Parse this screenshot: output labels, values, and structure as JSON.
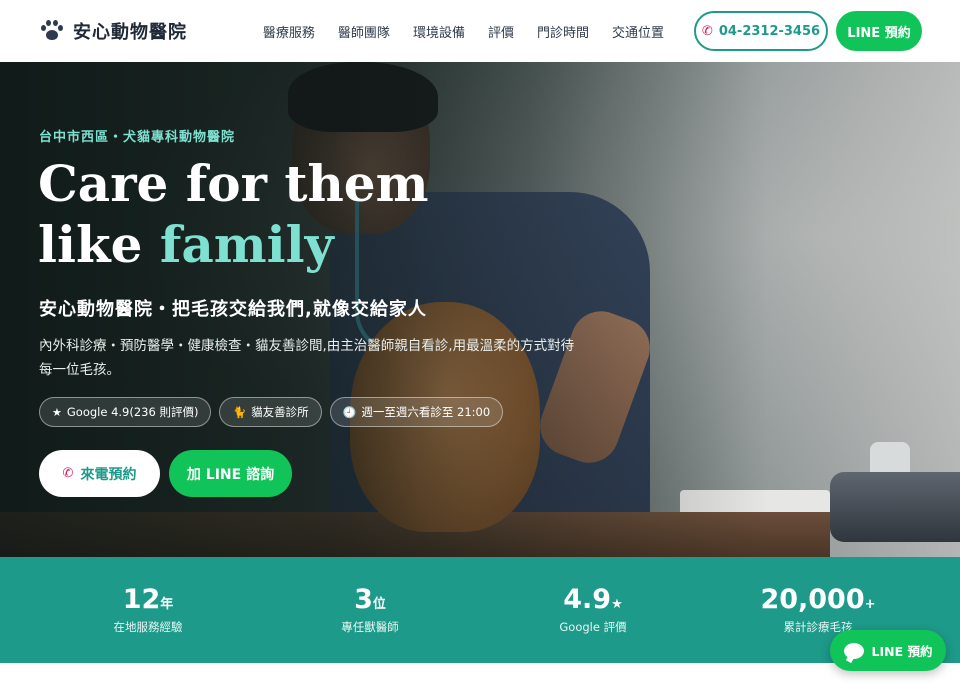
{
  "nav": {
    "brand": "安心動物醫院",
    "menu": [
      "醫療服務",
      "醫師團隊",
      "環境設備",
      "評價",
      "門診時間",
      "交通位置"
    ],
    "phone": "04-2312-3456",
    "line_button": "LINE 預約"
  },
  "hero": {
    "eyebrow": "台中市西區・犬貓專科動物醫院",
    "headline_line1": "Care for them",
    "headline_line2_prefix": "like ",
    "headline_line2_accent": "family",
    "subhead": "安心動物醫院・把毛孩交給我們,就像交給家人",
    "description": "內外科診療・預防醫學・健康檢查・貓友善診間,由主治醫師親自看診,用最溫柔的方式對待每一位毛孩。",
    "tags": [
      {
        "icon": "★",
        "label": "Google 4.9(236 則評價)"
      },
      {
        "icon": "🐈",
        "label": "貓友善診所"
      },
      {
        "icon": "🕘",
        "label": "週一至週六看診至 21:00"
      }
    ],
    "cta_call": "來電預約",
    "cta_line": "加 LINE 諮詢"
  },
  "stats": [
    {
      "value": "12",
      "unit": "年",
      "label": "在地服務經驗"
    },
    {
      "value": "3",
      "unit": "位",
      "label": "專任獸醫師"
    },
    {
      "value": "4.9",
      "unit": "★",
      "label": "Google 評價"
    },
    {
      "value": "20,000",
      "unit": "+",
      "label": "累計診療毛孩"
    }
  ],
  "float_line": "LINE 預約",
  "colors": {
    "teal": "#1e9a8a",
    "line_green": "#10c45a",
    "accent_mint": "#7ee0d0"
  }
}
